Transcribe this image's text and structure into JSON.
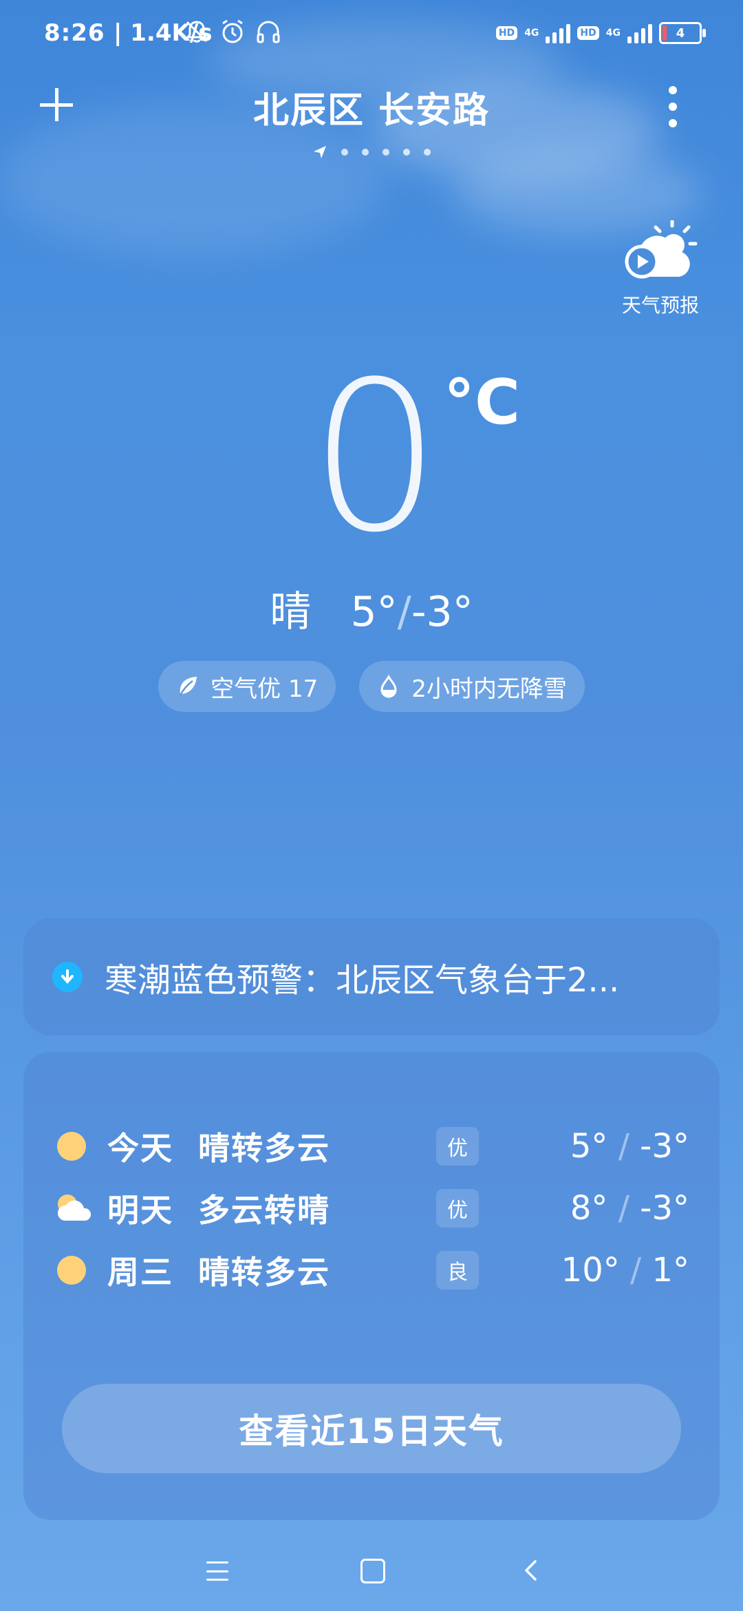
{
  "status": {
    "time": "8:26",
    "net_speed": "| 1.4K/s",
    "hd1": "HD",
    "g1": "4G",
    "hd2": "HD",
    "g2": "4G",
    "battery": "4"
  },
  "header": {
    "location": "北辰区 长安路",
    "page_dots_count": 5
  },
  "video": {
    "label": "天气预报"
  },
  "current": {
    "temp": "0",
    "unit": "°C",
    "condition": "晴",
    "high": "5°",
    "slash": "/",
    "low": "-3°"
  },
  "chips": {
    "air": "空气优 17",
    "precip": "2小时内无降雪"
  },
  "alert": {
    "text": "寒潮蓝色预警：北辰区气象台于2..."
  },
  "forecast": [
    {
      "day": "今天",
      "cond": "晴转多云",
      "aqi": "优",
      "high": "5°",
      "low": "-3°",
      "icon": "sun-icon"
    },
    {
      "day": "明天",
      "cond": "多云转晴",
      "aqi": "优",
      "high": "8°",
      "low": "-3°",
      "icon": "cloud-sun-icon"
    },
    {
      "day": "周三",
      "cond": "晴转多云",
      "aqi": "良",
      "high": "10°",
      "low": "1°",
      "icon": "sun-icon"
    }
  ],
  "forecast_button": "查看近15日天气",
  "colors": {
    "sky_top": "#3f86d9",
    "sky_bottom": "#6aa8ea",
    "sun": "#ffd27a",
    "alert_icon": "#1fb6ff"
  }
}
